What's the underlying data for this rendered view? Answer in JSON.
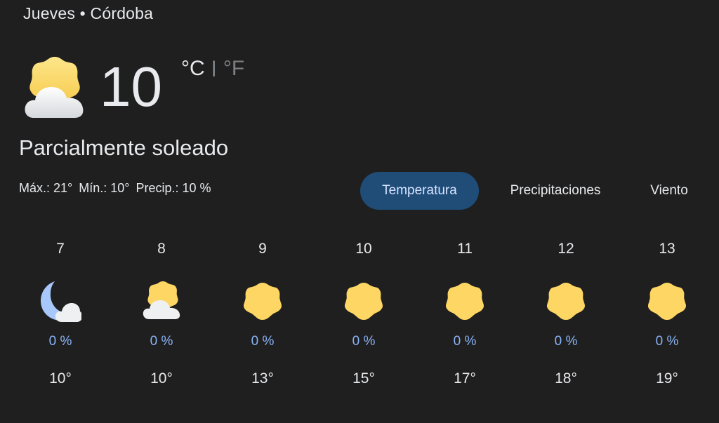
{
  "header": {
    "day": "Jueves",
    "separator": "•",
    "location": "Córdoba"
  },
  "current": {
    "temperature": "10",
    "unit_c": "°C",
    "unit_separator": "|",
    "unit_f": "°F",
    "condition": "Parcialmente soleado",
    "icon": "partly-sunny-icon",
    "max": "Máx.: 21°",
    "min": "Mín.: 10°",
    "precip": "Precip.: 10 %"
  },
  "tabs": [
    {
      "label": "Temperatura",
      "active": true
    },
    {
      "label": "Precipitaciones",
      "active": false
    },
    {
      "label": "Viento",
      "active": false
    }
  ],
  "hours": [
    {
      "hour": "7",
      "icon": "night-partly-cloudy-icon",
      "precip": "0 %",
      "temp": "10°"
    },
    {
      "hour": "8",
      "icon": "partly-sunny-icon",
      "precip": "0 %",
      "temp": "10°"
    },
    {
      "hour": "9",
      "icon": "sunny-icon",
      "precip": "0 %",
      "temp": "13°"
    },
    {
      "hour": "10",
      "icon": "sunny-icon",
      "precip": "0 %",
      "temp": "15°"
    },
    {
      "hour": "11",
      "icon": "sunny-icon",
      "precip": "0 %",
      "temp": "17°"
    },
    {
      "hour": "12",
      "icon": "sunny-icon",
      "precip": "0 %",
      "temp": "18°"
    },
    {
      "hour": "13",
      "icon": "sunny-icon",
      "precip": "0 %",
      "temp": "19°"
    }
  ],
  "colors": {
    "background": "#1f1f1f",
    "sun": "#fdd663",
    "cloud": "#f1f3f4",
    "moon": "#a8c7fa",
    "precip_text": "#8ab4f8",
    "active_tab": "#1f4d78"
  }
}
